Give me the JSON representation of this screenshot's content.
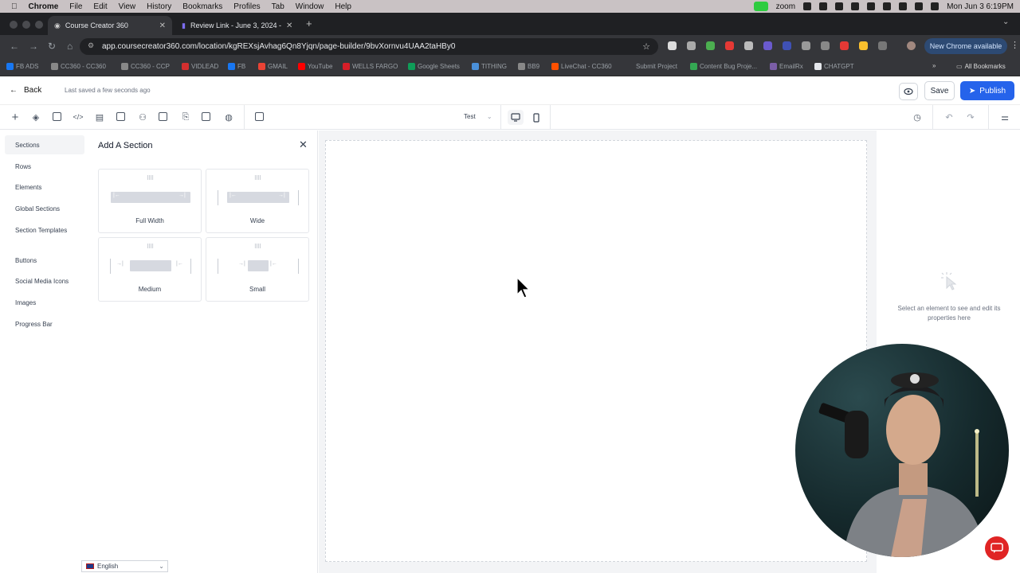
{
  "menubar": {
    "apple": "",
    "items": [
      "Chrome",
      "File",
      "Edit",
      "View",
      "History",
      "Bookmarks",
      "Profiles",
      "Tab",
      "Window",
      "Help"
    ],
    "zoom_label": "zoom",
    "clock": "Mon Jun 3  6:19PM"
  },
  "tabs": [
    {
      "title": "Course Creator 360",
      "active": true
    },
    {
      "title": "Review Link - June 3, 2024 -",
      "active": false
    }
  ],
  "omnibox": {
    "url": "app.coursecreator360.com/location/kgREXsjAvhag6Qn8Yjqn/page-builder/9bvXornvu4UAA2taHBy0"
  },
  "chrome_update": "New Chrome available",
  "bookmarks": [
    {
      "label": "FB ADS",
      "color": "#1877f2"
    },
    {
      "label": "CC360 - CC360",
      "color": "#888888"
    },
    {
      "label": "CC360 - CCP",
      "color": "#888888"
    },
    {
      "label": "VIDLEAD",
      "color": "#d32f2f"
    },
    {
      "label": "FB",
      "color": "#1877f2"
    },
    {
      "label": "GMAIL",
      "color": "#ea4335"
    },
    {
      "label": "YouTube",
      "color": "#ff0000"
    },
    {
      "label": "WELLS FARGO",
      "color": "#d71e28"
    },
    {
      "label": "Google Sheets",
      "color": "#0f9d58"
    },
    {
      "label": "TITHING",
      "color": "#4a90d9"
    },
    {
      "label": "BB9",
      "color": "#888888"
    },
    {
      "label": "LiveChat - CC360",
      "color": "#ff5100"
    },
    {
      "label": "Submit Project",
      "color": "#35363a"
    },
    {
      "label": "Content Bug Proje...",
      "color": "#34a853"
    },
    {
      "label": "EmailRx",
      "color": "#7b5ea7"
    },
    {
      "label": "CHATGPT",
      "color": "#e5e7eb"
    }
  ],
  "all_bookmarks": "All Bookmarks",
  "appbar": {
    "back_label": "Back",
    "saved_text": "Last saved a few seconds ago",
    "save_label": "Save",
    "publish_label": "Publish"
  },
  "toolsbar": {
    "device_select": "Test"
  },
  "leftnav": {
    "items": [
      "Sections",
      "Rows",
      "Elements",
      "Global Sections",
      "Section Templates",
      "Buttons",
      "Social Media Icons",
      "Images",
      "Progress Bar"
    ]
  },
  "panel": {
    "title": "Add A Section",
    "cards": [
      {
        "label": "Full Width"
      },
      {
        "label": "Wide"
      },
      {
        "label": "Medium"
      },
      {
        "label": "Small"
      }
    ]
  },
  "language": "English",
  "rightpanel": {
    "hint": "Select an element to see and edit its properties here"
  },
  "colors": {
    "accent": "#2563eb",
    "chat": "#e02424"
  }
}
